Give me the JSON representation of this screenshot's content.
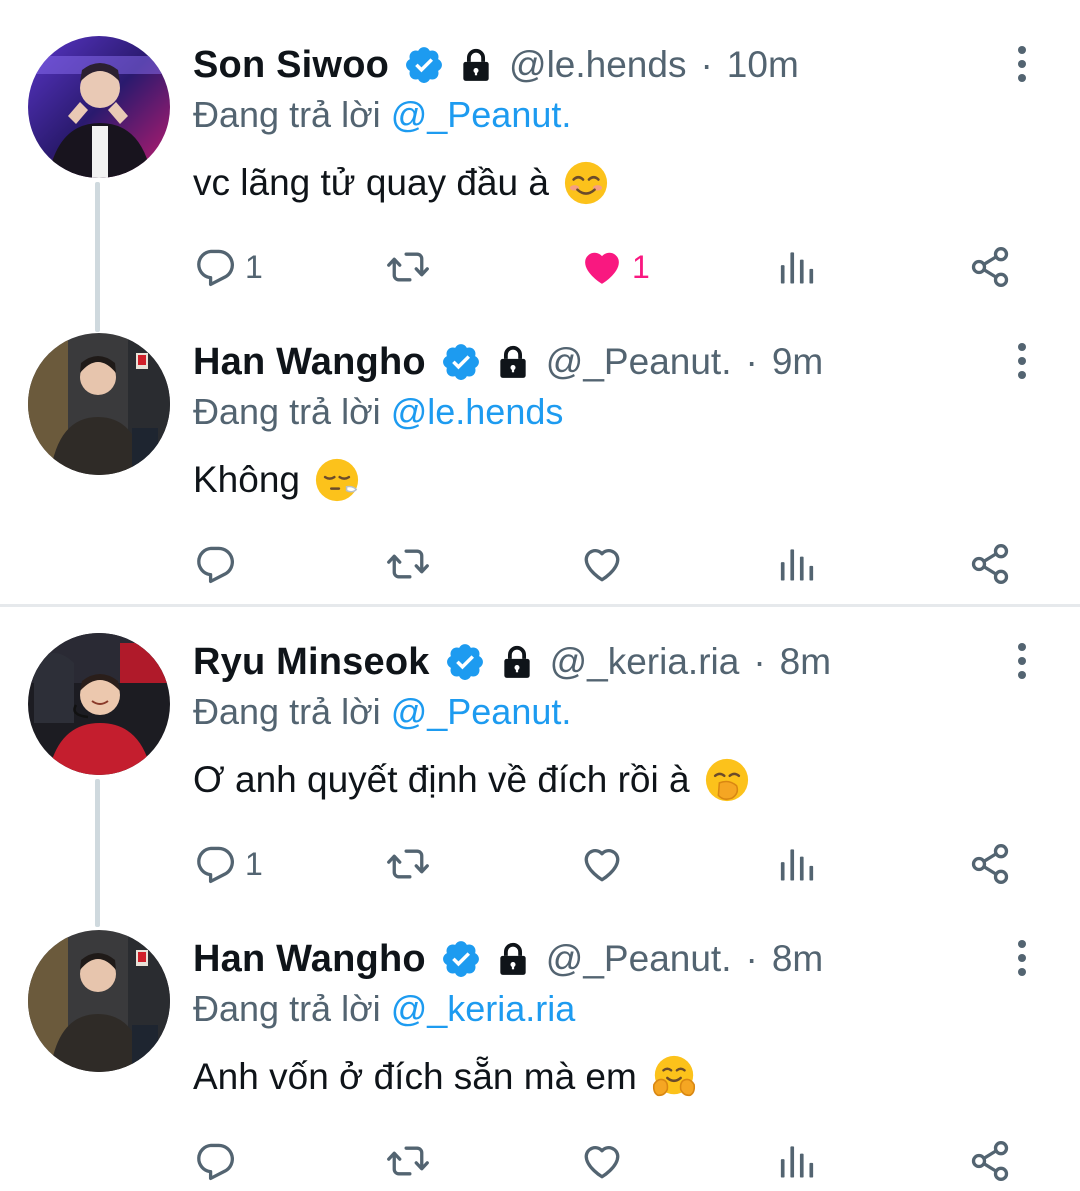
{
  "reply_prefix": "Đang trả lời",
  "colors": {
    "accent": "#1d9bf0",
    "like": "#f91880",
    "muted": "#536471",
    "text": "#0f1419"
  },
  "tweets": [
    {
      "name": "Son Siwoo",
      "handle": "@le.hends",
      "time": "10m",
      "reply_to": "@_Peanut.",
      "text": "vc lãng tử quay đầu à",
      "emoji": "smiling-blush-emoji",
      "reply_count": "1",
      "like_count": "1",
      "liked": true
    },
    {
      "name": "Han Wangho",
      "handle": "@_Peanut.",
      "time": "9m",
      "reply_to": "@le.hends",
      "text": "Không",
      "emoji": "face-exhaling-emoji",
      "reply_count": "",
      "like_count": "",
      "liked": false
    },
    {
      "name": "Ryu Minseok",
      "handle": "@_keria.ria",
      "time": "8m",
      "reply_to": "@_Peanut.",
      "text": "Ơ anh quyết định về đích rồi à",
      "emoji": "hand-over-mouth-emoji",
      "reply_count": "1",
      "like_count": "",
      "liked": false
    },
    {
      "name": "Han Wangho",
      "handle": "@_Peanut.",
      "time": "8m",
      "reply_to": "@_keria.ria",
      "text": "Anh vốn ở đích sẵn mà em",
      "emoji": "hugging-face-emoji",
      "reply_count": "",
      "like_count": "",
      "liked": false
    }
  ]
}
